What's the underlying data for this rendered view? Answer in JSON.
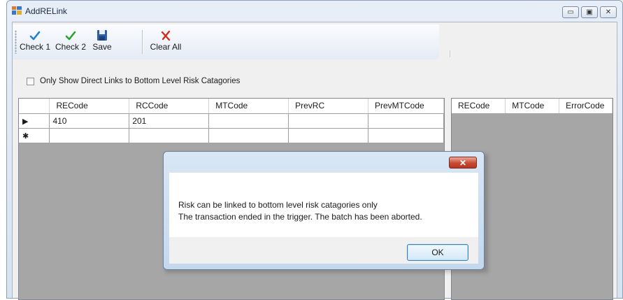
{
  "window": {
    "title": "AddRELink",
    "min_glyph": "▭",
    "max_glyph": "▣",
    "close_glyph": "✕"
  },
  "toolbar": {
    "check1_label": "Check 1",
    "check2_label": "Check 2",
    "save_label": "Save",
    "clear_label": "Clear All"
  },
  "filter": {
    "checkbox_label": "Only Show Direct Links to Bottom Level Risk Catagories",
    "checked": false
  },
  "left_grid": {
    "columns": [
      "RECode",
      "RCCode",
      "MTCode",
      "PrevRC",
      "PrevMTCode"
    ],
    "rows": [
      {
        "indicator": "▶",
        "cells": [
          "410",
          "201",
          "",
          "",
          ""
        ]
      },
      {
        "indicator": "✱",
        "cells": [
          "",
          "",
          "",
          "",
          ""
        ]
      }
    ]
  },
  "right_grid": {
    "columns": [
      "RECode",
      "MTCode",
      "ErrorCode"
    ]
  },
  "dialog": {
    "line1": "Risk can be linked to bottom level risk catagories only",
    "line2": "The transaction ended in the trigger. The batch has been aborted.",
    "ok_label": "OK",
    "close_glyph": "✕"
  },
  "colors": {
    "selection": "#3399ff",
    "check_green": "#2aa52a",
    "check_blue": "#1e7fd6",
    "clear_red": "#d42a1c",
    "close_red": "#c84a32"
  }
}
